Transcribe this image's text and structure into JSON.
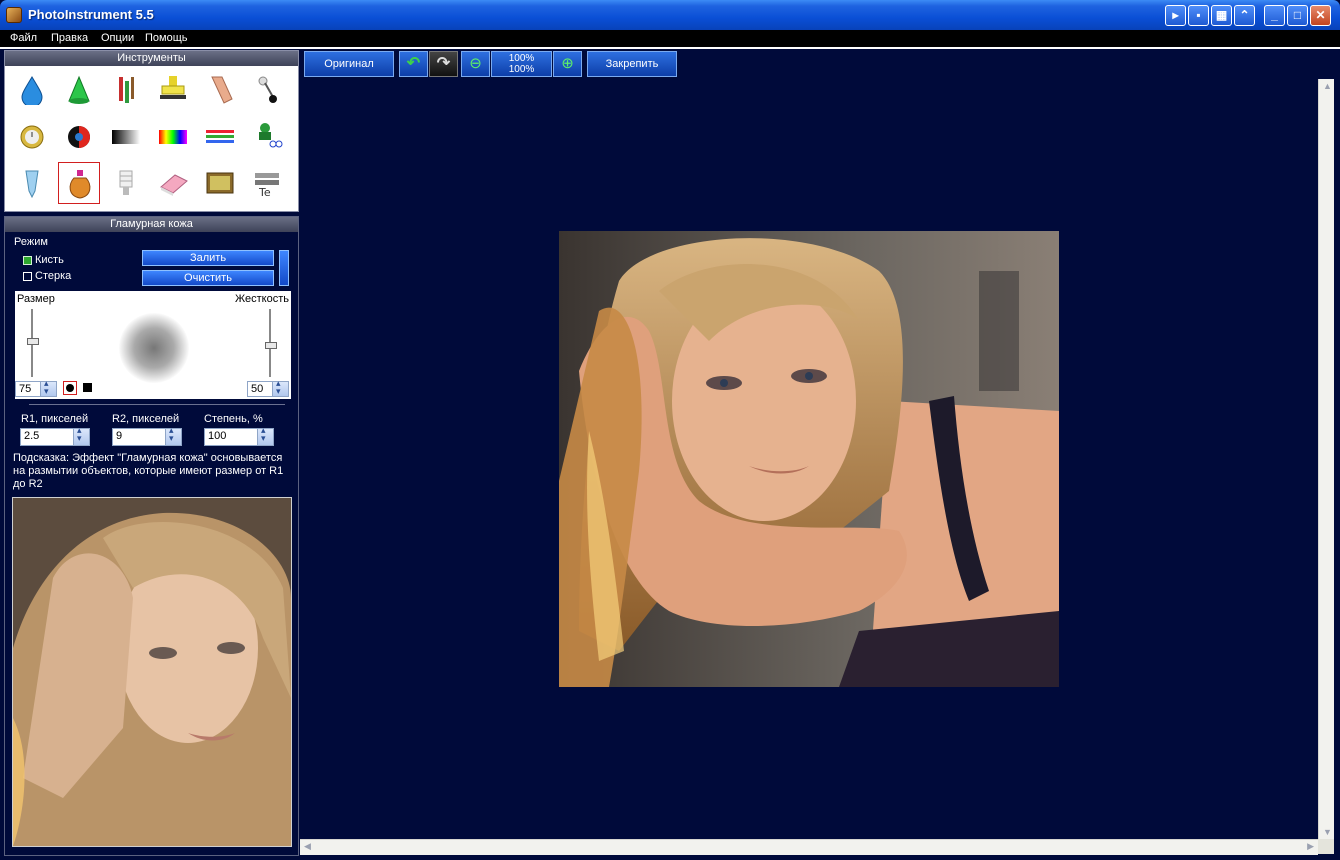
{
  "window": {
    "title": "PhotoInstrument 5.5"
  },
  "menu": [
    "Файл",
    "Правка",
    "Опции",
    "Помощь"
  ],
  "tools_panel": {
    "title": "Инструменты",
    "tools": [
      "water-drop-icon",
      "green-cone-icon",
      "paint-brushes-icon",
      "stamp-icon",
      "finger-smudge-icon",
      "pin-icon",
      "clock-icon",
      "eye-icon",
      "gradient-icon",
      "rainbow-icon",
      "lines-icon",
      "clone-scissors-icon",
      "pipette-icon",
      "glamour-bottle-icon",
      "lamp-icon",
      "eraser-icon",
      "tv-icon",
      "text-layers-icon"
    ],
    "selected_index": 13
  },
  "glamour_panel": {
    "title": "Гламурная кожа",
    "mode_label": "Режим",
    "brush_label": "Кисть",
    "eraser_label": "Стерка",
    "brush_checked": true,
    "fill_button": "Залить",
    "clear_button": "Очистить",
    "size_label": "Размер",
    "hardness_label": "Жесткость",
    "size_value": "75",
    "hardness_value": "50",
    "r1_label": "R1, пикселей",
    "r2_label": "R2, пикселей",
    "degree_label": "Степень, %",
    "r1_value": "2.5",
    "r2_value": "9",
    "degree_value": "100",
    "hint": "Подсказка: Эффект \"Гламурная кожа\" основывается на размытии объектов, которые имеют размер от R1 до R2"
  },
  "toolbar": {
    "original_button": "Оригинал",
    "zoom_top": "100%",
    "zoom_bottom": "100%",
    "pin_button": "Закрепить"
  },
  "colors": {
    "workspace_bg": "#000a3a",
    "title_bar": "#0a4fd6",
    "button_blue": "#1e5ad3",
    "selected_tool_border": "#d21f1f"
  }
}
